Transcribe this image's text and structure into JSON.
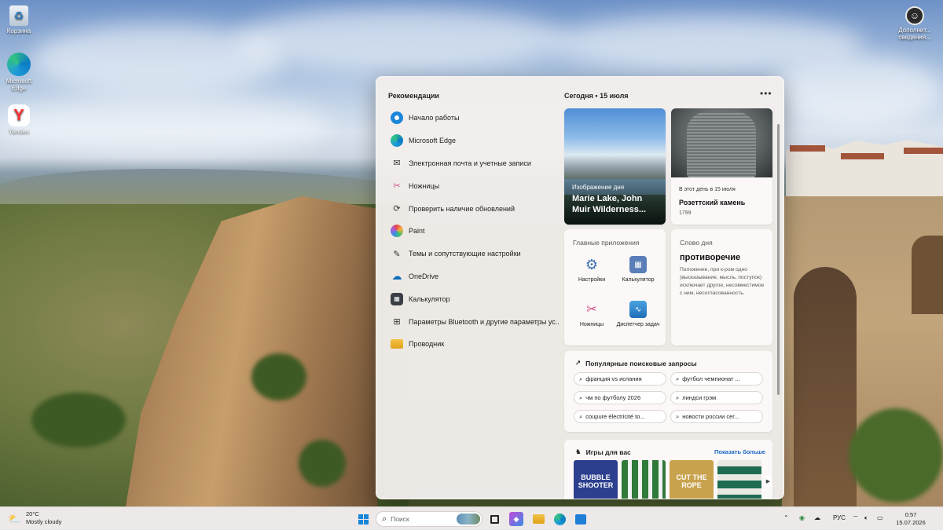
{
  "desktop": {
    "icons": [
      {
        "label": "Корзина"
      },
      {
        "label": "Microsoft Edge"
      },
      {
        "label": "Yandex"
      },
      {
        "label": "Дополнит... сведения..."
      }
    ]
  },
  "widgets": {
    "recommendations_title": "Рекомендации",
    "recommendations": [
      {
        "label": "Начало работы",
        "icon": "get-started-icon"
      },
      {
        "label": "Microsoft Edge",
        "icon": "edge-icon"
      },
      {
        "label": "Электронная почта и учетные записи",
        "icon": "mail-icon"
      },
      {
        "label": "Ножницы",
        "icon": "snipping-tool-icon"
      },
      {
        "label": "Проверить наличие обновлений",
        "icon": "update-icon"
      },
      {
        "label": "Paint",
        "icon": "paint-icon"
      },
      {
        "label": "Темы и сопутствующие настройки",
        "icon": "brush-icon"
      },
      {
        "label": "OneDrive",
        "icon": "onedrive-icon"
      },
      {
        "label": "Калькулятор",
        "icon": "calculator-icon"
      },
      {
        "label": "Параметры Bluetooth и другие параметры ус...",
        "icon": "bluetooth-settings-icon"
      },
      {
        "label": "Проводник",
        "icon": "file-explorer-icon"
      }
    ],
    "feed_date": "Сегодня  •  15 июля",
    "more_label": "•••",
    "photo_card": {
      "label": "Изображение дня",
      "title": "Marie Lake, John Muir Wilderness..."
    },
    "history_card": {
      "subtitle": "В этот день в 15 июля",
      "title": "Розеттский камень",
      "year": "1799"
    },
    "apps_card": {
      "title": "Главные приложения",
      "apps": [
        {
          "label": "Настройки",
          "icon": "settings-gear-icon"
        },
        {
          "label": "Калькулятор",
          "icon": "calculator-icon"
        },
        {
          "label": "Ножницы",
          "icon": "snipping-tool-icon"
        },
        {
          "label": "Диспетчер задач",
          "icon": "task-manager-icon"
        }
      ]
    },
    "word_card": {
      "title": "Слово дня",
      "word": "противоречие",
      "definition": "Положение, при к-ром одно (высказывание, мысль, поступок) исключает другое, несовместимое с ним, несогласованность."
    },
    "search_card": {
      "title": "Популярные поисковые запросы",
      "queries": [
        "франция vs испания",
        "футбол чемпионат ...",
        "чм по футболу 2026",
        "линдси грэм",
        "coupure électricité to...",
        "новости россии сег..."
      ]
    },
    "games_card": {
      "title": "Игры для вас",
      "show_more": "Показать больше",
      "games": [
        {
          "label": "BUBBLE SHOOTER",
          "color": "#2c3f8f"
        },
        {
          "label": "",
          "color": "#2f7a3a"
        },
        {
          "label": "CUT THE ROPE",
          "color": "#c9a24e"
        },
        {
          "label": "",
          "color": "#1f6b52"
        }
      ]
    }
  },
  "taskbar": {
    "weather_temp": "20°C",
    "weather_desc": "Mostly cloudy",
    "search_placeholder": "Поиск",
    "language": "РУС",
    "time": "0:57",
    "date": "15.07.2026"
  }
}
